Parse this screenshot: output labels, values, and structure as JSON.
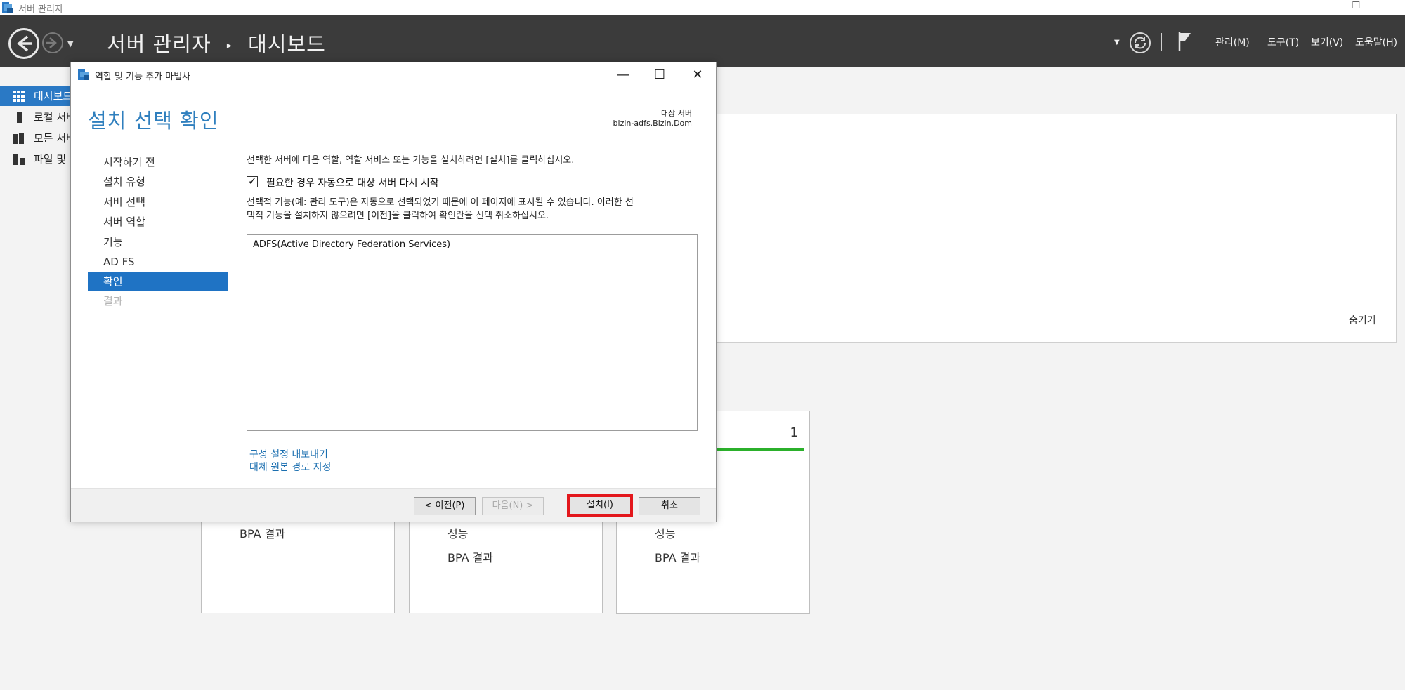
{
  "window": {
    "title": "서버 관리자",
    "buttons": {
      "minimize": "—",
      "restore": "❐"
    }
  },
  "header": {
    "breadcrumb": [
      "서버 관리자",
      "대시보드"
    ],
    "separator": "▸",
    "menus": [
      "관리(M)",
      "도구(T)",
      "보기(V)",
      "도움말(H)"
    ]
  },
  "sidebar": {
    "items": [
      {
        "label": "대시보드",
        "active": true
      },
      {
        "label": "로컬 서버"
      },
      {
        "label": "모든 서버"
      },
      {
        "label": "파일 및 저장소 서비스"
      }
    ]
  },
  "dashboard": {
    "hide_label": "숨기기",
    "tiles": [
      {
        "lines": [
          "BPA 결과"
        ]
      },
      {
        "lines": [
          "성능",
          "BPA 결과"
        ]
      },
      {
        "count": "1",
        "lines": [
          "성능",
          "BPA 결과"
        ]
      }
    ]
  },
  "dialog": {
    "title": "역할 및 기능 추가 마법사",
    "heading": "설치 선택 확인",
    "destination_label": "대상 서버",
    "destination_server": "bizin-adfs.Bizin.Dom",
    "steps": [
      {
        "label": "시작하기 전"
      },
      {
        "label": "설치 유형"
      },
      {
        "label": "서버 선택"
      },
      {
        "label": "서버 역할"
      },
      {
        "label": "기능"
      },
      {
        "label": "AD FS"
      },
      {
        "label": "확인",
        "state": "active"
      },
      {
        "label": "결과",
        "state": "disabled"
      }
    ],
    "intro": "선택한 서버에 다음 역할, 역할 서비스 또는 기능을 설치하려면 [설치]를 클릭하십시오.",
    "restart_checkbox": {
      "label": "필요한 경우 자동으로 대상 서버 다시 시작",
      "checked": true
    },
    "note_line1": "선택적 기능(예: 관리 도구)은 자동으로 선택되었기 때문에 이 페이지에 표시될 수 있습니다. 이러한 선",
    "note_line2": "택적 기능을 설치하지 않으려면 [이전]을 클릭하여 확인란을 선택 취소하십시오.",
    "selected_items": [
      "ADFS(Active Directory Federation Services)"
    ],
    "links": [
      "구성 설정 내보내기",
      "대체 원본 경로 지정"
    ],
    "buttons": {
      "previous": "< 이전(P)",
      "next": "다음(N) >",
      "install": "설치(I)",
      "cancel": "취소"
    },
    "window_buttons": {
      "minimize": "—",
      "maximize": "☐",
      "close": "✕"
    }
  },
  "colors": {
    "header_bg": "#3b3b3b",
    "accent_blue": "#1f73c4",
    "heading_blue": "#2f7fbe",
    "highlight_red": "#e3171c",
    "tile_green": "#2bb02b"
  }
}
